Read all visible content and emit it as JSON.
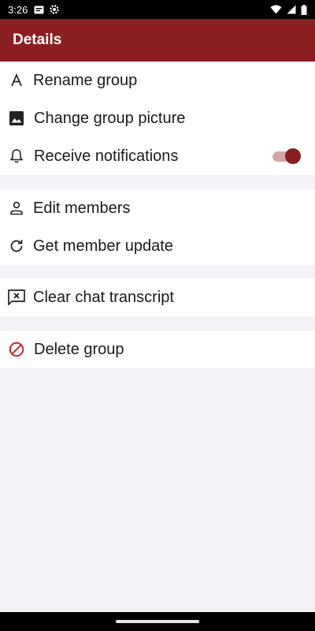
{
  "status_bar": {
    "time": "3:26",
    "icons": [
      "message-notification-icon",
      "settings-gear-icon",
      "wifi-icon",
      "cellular-signal-icon",
      "battery-icon"
    ]
  },
  "app_bar": {
    "title": "Details"
  },
  "sections": [
    {
      "items": [
        {
          "label": "Rename group",
          "icon": "rename-text-icon"
        },
        {
          "label": "Change group picture",
          "icon": "image-icon"
        },
        {
          "label": "Receive notifications",
          "icon": "bell-icon",
          "toggle_on": true
        }
      ]
    },
    {
      "items": [
        {
          "label": "Edit members",
          "icon": "person-icon"
        },
        {
          "label": "Get member update",
          "icon": "refresh-icon"
        }
      ]
    },
    {
      "items": [
        {
          "label": "Clear chat transcript",
          "icon": "clear-chat-icon"
        }
      ]
    },
    {
      "items": [
        {
          "label": "Delete group",
          "icon": "delete-block-icon"
        }
      ]
    }
  ],
  "colors": {
    "accent": "#8a1f22",
    "toggle_track": "#d5a4a6",
    "background": "#f2f2f7",
    "delete_icon": "#c62828"
  }
}
